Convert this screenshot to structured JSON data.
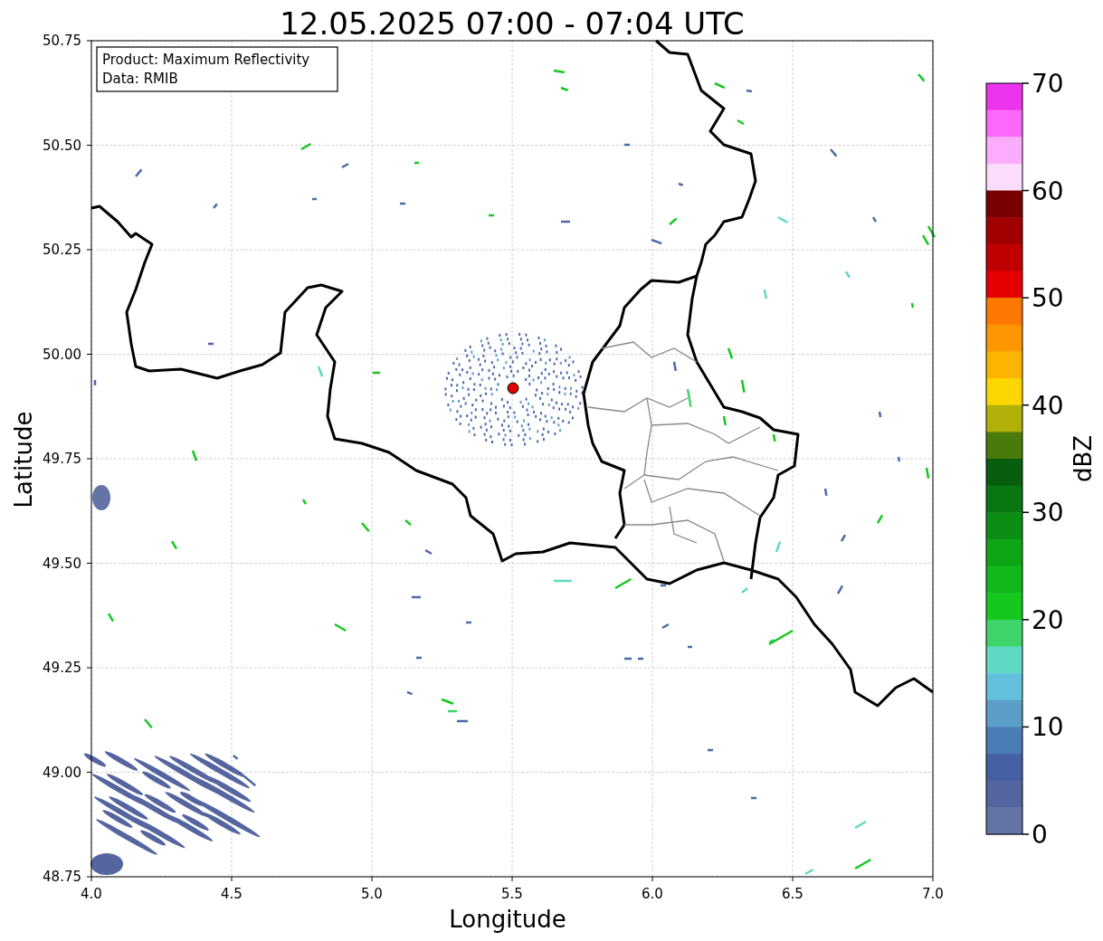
{
  "title": "12.05.2025 07:00 - 07:04 UTC",
  "info_box": [
    "Product: Maximum Reflectivity",
    "Data: RMIB"
  ],
  "x_axis": {
    "label": "Longitude",
    "ticks": [
      "4.0",
      "4.5",
      "5.0",
      "5.5",
      "6.0",
      "6.5",
      "7.0"
    ]
  },
  "y_axis": {
    "label": "Latitude",
    "ticks": [
      "50.75",
      "50.50",
      "50.25",
      "50.00",
      "49.75",
      "49.50",
      "49.25",
      "49.00",
      "48.75"
    ]
  },
  "colorbar": {
    "label": "dBZ",
    "ticks": [
      "70",
      "60",
      "50",
      "40",
      "30",
      "20",
      "10",
      "0"
    ],
    "segments": [
      {
        "color": "#ec34ec"
      },
      {
        "color": "#fc68fc"
      },
      {
        "color": "#fcacfc"
      },
      {
        "color": "#fcdcfc"
      },
      {
        "color": "#780000"
      },
      {
        "color": "#a00000"
      },
      {
        "color": "#c00000"
      },
      {
        "color": "#e40000"
      },
      {
        "color": "#fc7800"
      },
      {
        "color": "#fc9600"
      },
      {
        "color": "#fcb400"
      },
      {
        "color": "#fcd600"
      },
      {
        "color": "#b0b008"
      },
      {
        "color": "#4a7a0c"
      },
      {
        "color": "#075e0c"
      },
      {
        "color": "#0a7612"
      },
      {
        "color": "#0c8e14"
      },
      {
        "color": "#0ea616"
      },
      {
        "color": "#10b81a"
      },
      {
        "color": "#14c81e"
      },
      {
        "color": "#3ed46a"
      },
      {
        "color": "#5fd8c4"
      },
      {
        "color": "#62c0dc"
      },
      {
        "color": "#5a9ec8"
      },
      {
        "color": "#4a7cb5"
      },
      {
        "color": "#4660a4"
      },
      {
        "color": "#5565a0"
      },
      {
        "color": "#6474a6"
      }
    ]
  }
}
